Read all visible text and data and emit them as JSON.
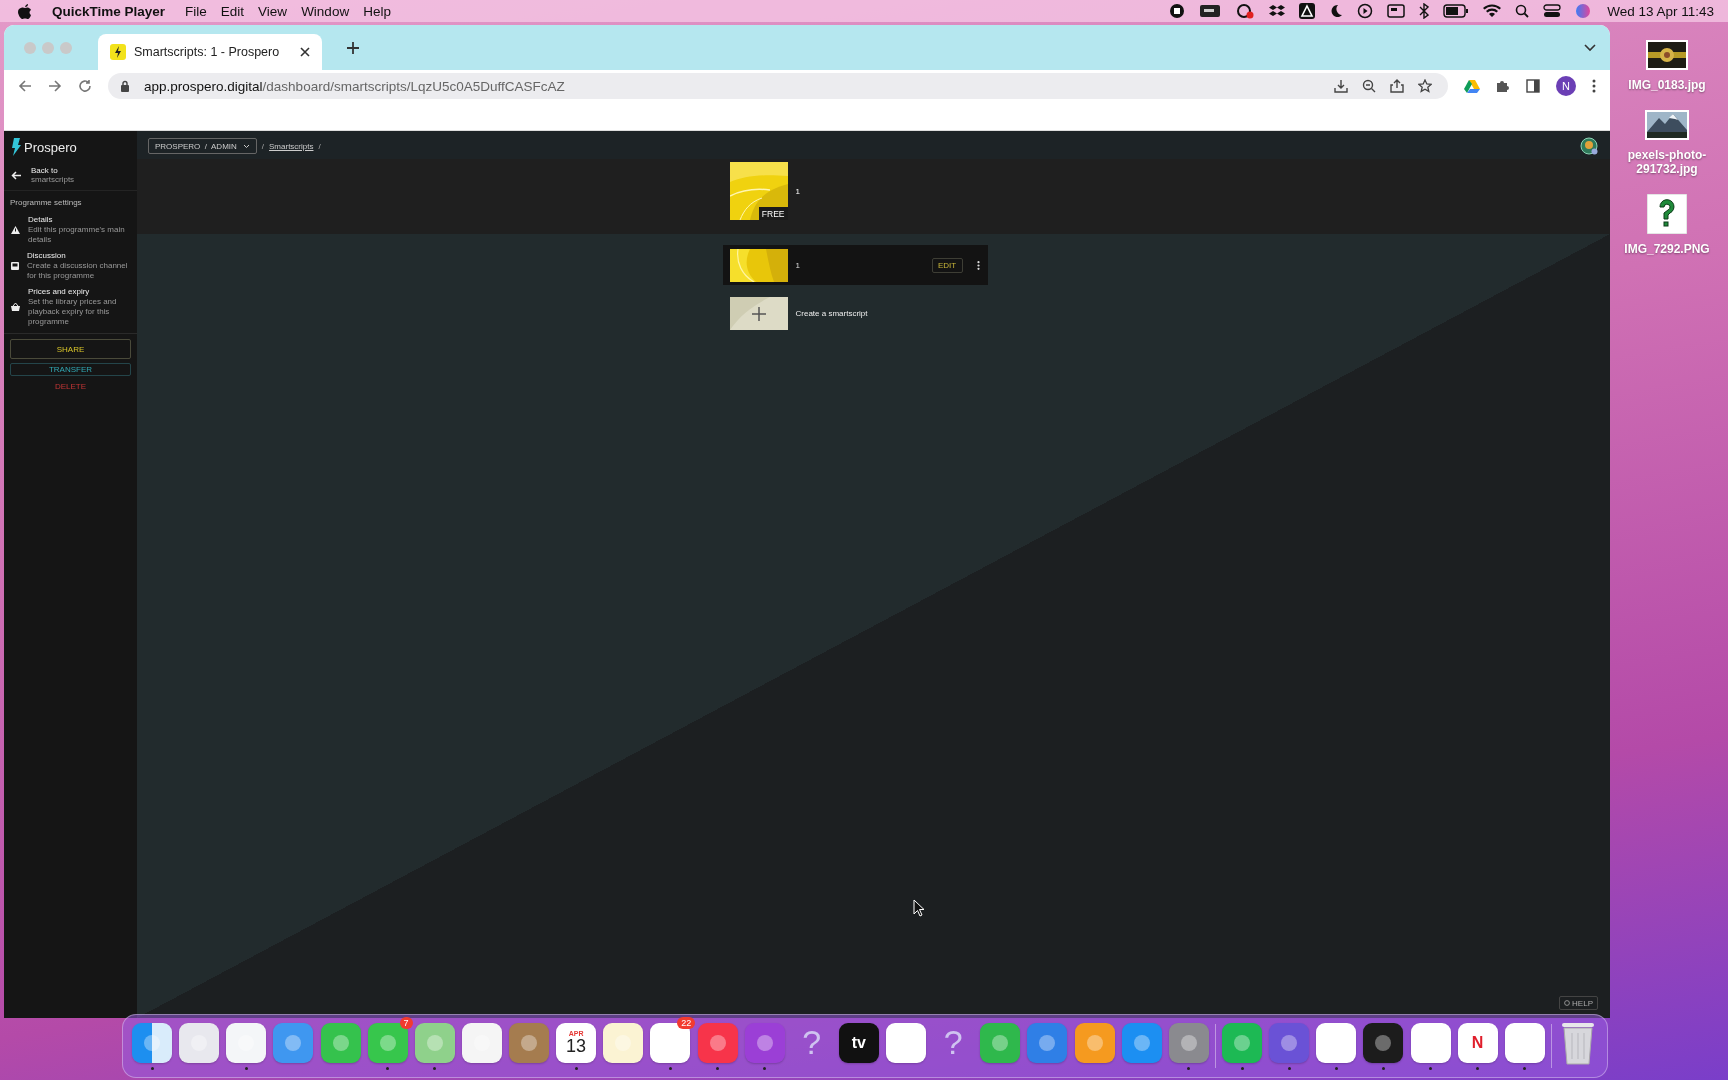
{
  "menubar": {
    "app": "QuickTime Player",
    "menus": [
      "File",
      "Edit",
      "View",
      "Window",
      "Help"
    ],
    "clock": "Wed 13 Apr  11:43"
  },
  "browser": {
    "tab": {
      "title": "Smartscripts: 1 - Prospero"
    },
    "url": {
      "host": "app.prospero.digital",
      "path": "/dashboard/smartscripts/LqzU5c0A5DuffCASFcAZ"
    },
    "profile": "N"
  },
  "sidebar": {
    "brand": "Prospero",
    "back": {
      "title": "Back to",
      "subtitle": "smartscripts"
    },
    "section": "Programme settings",
    "items": [
      {
        "kind": "warning",
        "title": "Details",
        "description": "Edit this programme's main details"
      },
      {
        "kind": "chat",
        "title": "Discussion",
        "description": "Create a discussion channel for this programme"
      },
      {
        "kind": "basket",
        "title": "Prices and expiry",
        "description": "Set the library prices and playback expiry for this programme"
      }
    ],
    "actions": [
      {
        "kind": "share",
        "label": "SHARE"
      },
      {
        "kind": "transfer",
        "label": "TRANSFER"
      },
      {
        "kind": "delete",
        "label": "DELETE"
      }
    ]
  },
  "breadcrumb": {
    "org": "PROSPERO  /  ADMIN",
    "crumbs": [
      {
        "kind": "separator",
        "text": "/"
      },
      {
        "kind": "link",
        "text": "Smartscripts"
      },
      {
        "kind": "separator",
        "text": "/"
      }
    ]
  },
  "programme": {
    "title": "1",
    "badge": "FREE"
  },
  "smartscripts": [
    {
      "title": "1",
      "action": "EDIT"
    }
  ],
  "create": {
    "label": "Create a smartscript"
  },
  "help": "HELP",
  "desktop": [
    {
      "name": "IMG_0183.jpg"
    },
    {
      "kind": "mountain",
      "name": "pexels-photo-291732.jpg"
    },
    {
      "kind": "question",
      "name": "IMG_7292.PNG"
    }
  ],
  "dock": [
    {
      "kind": "finder",
      "running": true
    },
    {
      "kind": "launchpad",
      "running": false
    },
    {
      "kind": "safari",
      "running": true
    },
    {
      "kind": "mail",
      "running": false
    },
    {
      "kind": "facetime",
      "running": false
    },
    {
      "kind": "messages",
      "running": true,
      "badge": "7"
    },
    {
      "kind": "maps",
      "running": true
    },
    {
      "kind": "photos",
      "running": false
    },
    {
      "kind": "contacts",
      "running": false
    },
    {
      "kind": "calendar",
      "running": true,
      "label": "APR",
      "sublabel": "13"
    },
    {
      "kind": "notes",
      "running": false
    },
    {
      "kind": "reminders",
      "running": true,
      "badge": "22"
    },
    {
      "kind": "music",
      "running": true
    },
    {
      "kind": "podcasts",
      "running": true
    },
    {
      "kind": "unknown",
      "running": false,
      "label": "?"
    },
    {
      "kind": "tv",
      "running": false,
      "label": "tv"
    },
    {
      "kind": "news",
      "running": false
    },
    {
      "kind": "unknown",
      "running": false,
      "label": "?"
    },
    {
      "kind": "numbers",
      "running": false
    },
    {
      "kind": "keynote",
      "running": false
    },
    {
      "kind": "pages",
      "running": false
    },
    {
      "kind": "appstore",
      "running": false
    },
    {
      "kind": "settings",
      "running": true
    },
    {
      "kind": "spotify",
      "running": true
    },
    {
      "kind": "imovie",
      "running": true
    },
    {
      "kind": "chrome",
      "running": true
    },
    {
      "kind": "quicktime",
      "running": true
    },
    {
      "kind": "wps",
      "running": true
    },
    {
      "kind": "netflix",
      "running": true,
      "label": "N"
    },
    {
      "kind": "messenger",
      "running": true
    },
    {
      "kind": "trash",
      "running": false
    }
  ]
}
